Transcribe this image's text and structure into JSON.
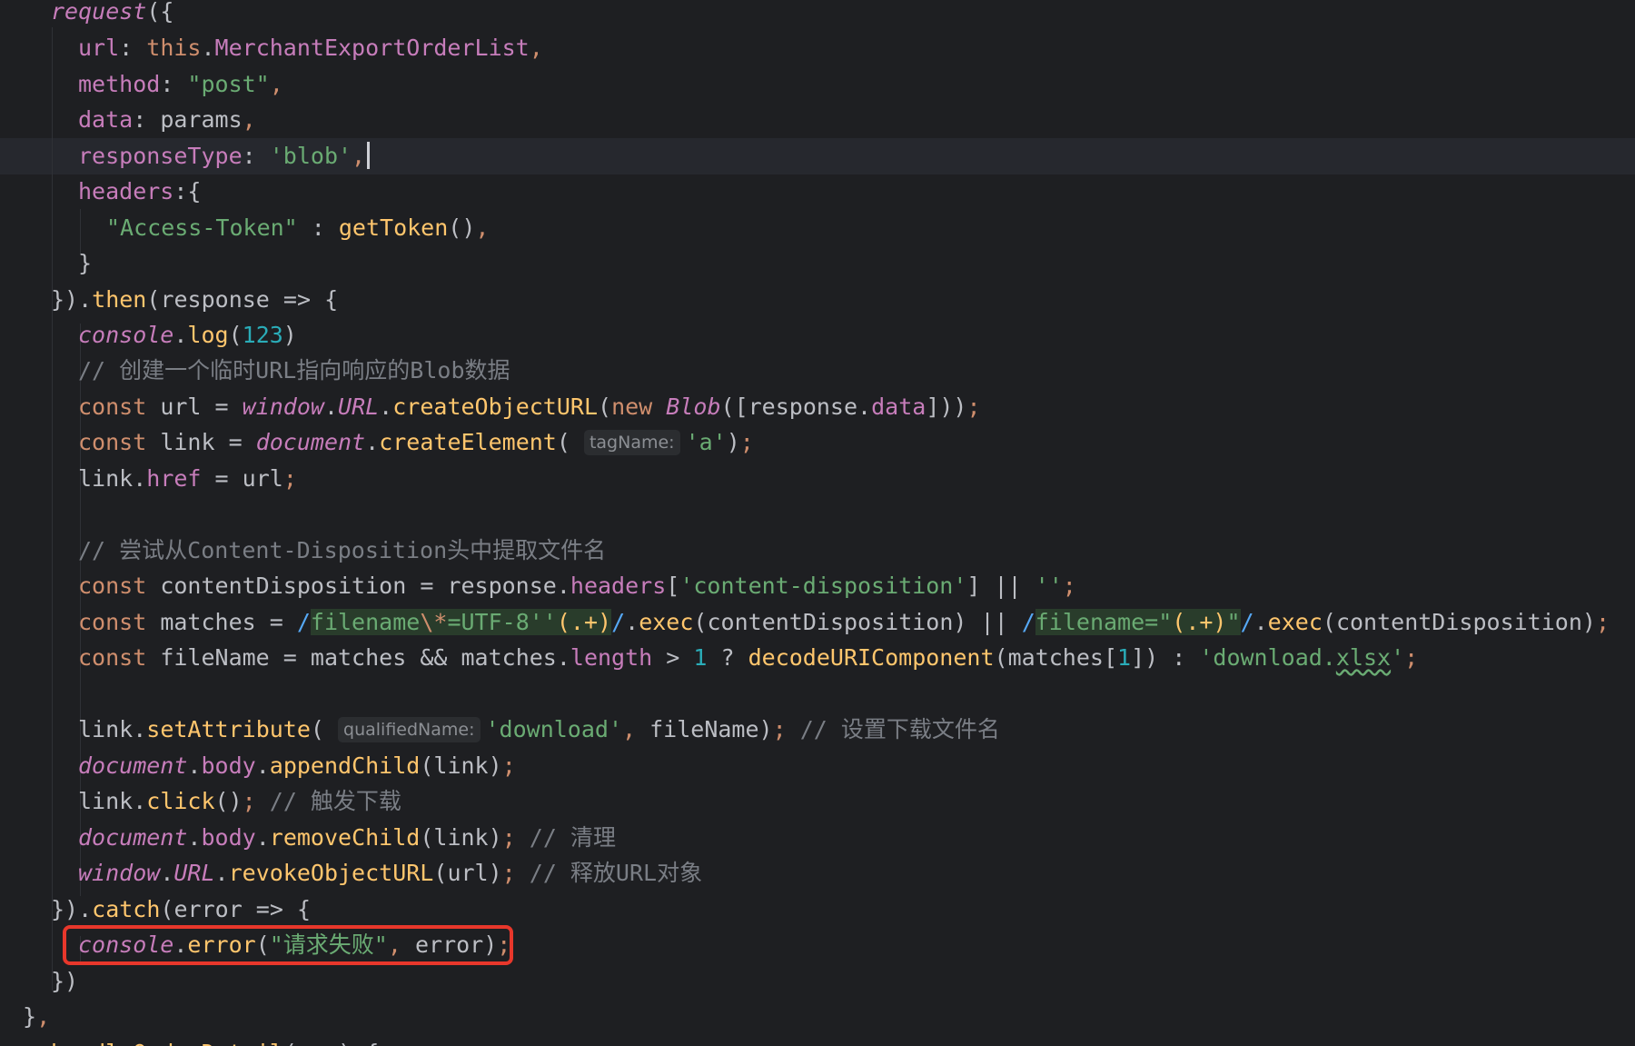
{
  "code": {
    "request_fn": "request",
    "key_url": "url",
    "kw_this": "this",
    "prop_export": "MerchantExportOrderList",
    "key_method": "method",
    "str_post": "\"post\"",
    "key_data": "data",
    "val_params": "params",
    "key_responseType": "responseType",
    "str_blob": "'blob'",
    "key_headers": "headers",
    "str_access_token": "\"Access-Token\"",
    "fn_getToken": "getToken",
    "fn_then": "then",
    "param_response": "response",
    "obj_console": "console",
    "fn_log": "log",
    "num_123": "123",
    "comment_1": "// 创建一个临时URL指向响应的Blob数据",
    "kw_const": "const",
    "var_url": "url",
    "obj_window": "window",
    "prop_URL": "URL",
    "fn_createObjectURL": "createObjectURL",
    "kw_new": "new",
    "class_Blob": "Blob",
    "prop_data": "data",
    "var_link": "link",
    "obj_document": "document",
    "fn_createElement": "createElement",
    "hint_tagName": "tagName:",
    "str_a": "'a'",
    "prop_href": "href",
    "comment_2": "// 尝试从Content-Disposition头中提取文件名",
    "var_contentDisposition": "contentDisposition",
    "prop_headers": "headers",
    "str_content_disposition": "'content-disposition'",
    "str_empty": "''",
    "var_matches": "matches",
    "regex1_a": "filename",
    "regex1_esc": "\\*",
    "regex1_b": "=UTF-8''",
    "regex1_group": "(.+)",
    "fn_exec": "exec",
    "regex2_a": "filename=\"",
    "regex2_group": "(.+)",
    "regex2_b": "\"",
    "var_fileName": "fileName",
    "prop_length": "length",
    "num_1": "1",
    "fn_decodeURIComponent": "decodeURIComponent",
    "str_download_a": "'download.",
    "str_download_b": "xlsx",
    "str_download_c": "'",
    "fn_setAttribute": "setAttribute",
    "hint_qualifiedName": "qualifiedName:",
    "str_download": "'download'",
    "comment_3": "// 设置下载文件名",
    "prop_body": "body",
    "fn_appendChild": "appendChild",
    "fn_click": "click",
    "comment_4": "// 触发下载",
    "fn_removeChild": "removeChild",
    "comment_5": "// 清理",
    "fn_revokeObjectURL": "revokeObjectURL",
    "comment_6": "// 释放URL对象",
    "fn_catch": "catch",
    "param_error": "error",
    "fn_error": "error",
    "str_request_failed": "\"请求失败\"",
    "tail_fn": "handleOrderDetail"
  },
  "colors": {
    "background": "#1e1f22",
    "highlight_box": "#e8372b",
    "keyword": "#cf8e6d",
    "string": "#6aab73",
    "function_call": "#ffc66d",
    "property": "#c77dbb",
    "number": "#2aacb8",
    "comment": "#7a7e85"
  }
}
